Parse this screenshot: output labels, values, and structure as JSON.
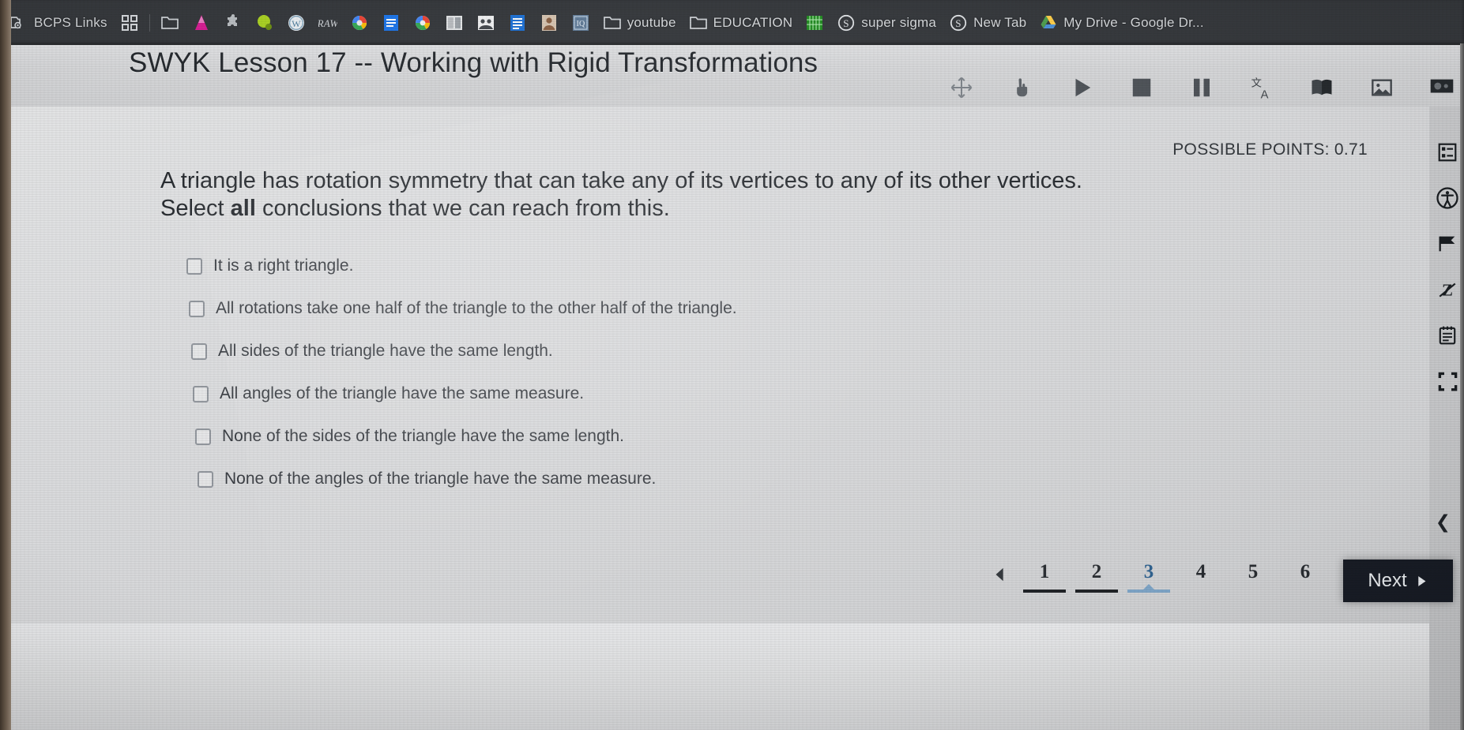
{
  "browser": {
    "bookmarks": [
      {
        "label": "BCPS Links",
        "icon": "folder-gear-icon",
        "kind": "folder"
      },
      {
        "label": "",
        "icon": "apps-grid-icon",
        "kind": "app"
      },
      {
        "label": "",
        "icon": "folder-icon",
        "kind": "folder"
      },
      {
        "label": "",
        "icon": "pink-cone-icon",
        "kind": "site"
      },
      {
        "label": "",
        "icon": "puzzle-piece-icon",
        "kind": "site"
      },
      {
        "label": "",
        "icon": "green-blob-icon",
        "kind": "site"
      },
      {
        "label": "",
        "icon": "wordpress-icon",
        "kind": "site"
      },
      {
        "label": "",
        "icon": "raw-text-icon",
        "kind": "site"
      },
      {
        "label": "",
        "icon": "google-icon",
        "kind": "site"
      },
      {
        "label": "",
        "icon": "blue-doc-icon",
        "kind": "site"
      },
      {
        "label": "",
        "icon": "google-multicolor-icon",
        "kind": "site"
      },
      {
        "label": "",
        "icon": "cards-icon",
        "kind": "site"
      },
      {
        "label": "",
        "icon": "people-photo-icon",
        "kind": "site"
      },
      {
        "label": "",
        "icon": "blue-document-icon",
        "kind": "site"
      },
      {
        "label": "",
        "icon": "portrait-photo-icon",
        "kind": "site"
      },
      {
        "label": "",
        "icon": "iq-blueprint-icon",
        "kind": "site"
      },
      {
        "label": "youtube",
        "icon": "folder-icon",
        "kind": "folder"
      },
      {
        "label": "EDUCATION",
        "icon": "folder-icon",
        "kind": "folder"
      },
      {
        "label": "",
        "icon": "green-grid-icon",
        "kind": "site"
      },
      {
        "label": "super sigma",
        "icon": "sigma-circle-icon",
        "kind": "site"
      },
      {
        "label": "New Tab",
        "icon": "sigma-circle-icon",
        "kind": "site"
      },
      {
        "label": "My Drive - Google Dr...",
        "icon": "google-drive-icon",
        "kind": "site"
      }
    ]
  },
  "header": {
    "title": "SWYK Lesson 17 -- Working with Rigid Transformations",
    "toolbar": [
      {
        "name": "move-tool",
        "glyph": "✥"
      },
      {
        "name": "hand-pointer-tool",
        "glyph": "☝"
      },
      {
        "name": "play-button",
        "glyph": "▶"
      },
      {
        "name": "stop-button",
        "glyph": "■"
      },
      {
        "name": "pause-button",
        "glyph": "❚❚"
      },
      {
        "name": "translate-icon",
        "glyph": "文A"
      },
      {
        "name": "book-icon",
        "glyph": "📖"
      },
      {
        "name": "image-icon",
        "glyph": "🖼"
      },
      {
        "name": "presentation-icon",
        "glyph": "📽"
      }
    ]
  },
  "assessment": {
    "possible_points_label": "POSSIBLE POINTS:",
    "possible_points_value": "0.71",
    "question_line1": "A triangle has rotation symmetry that can take any of its vertices to any of its other vertices.",
    "question_line2_prefix": "Select ",
    "question_line2_bold": "all",
    "question_line2_suffix": " conclusions that we can reach from this.",
    "options": [
      {
        "label": "It is a right triangle.",
        "checked": false
      },
      {
        "label": "All rotations take one half of the triangle to the other half of the triangle.",
        "checked": false
      },
      {
        "label": "All sides of the triangle have the same length.",
        "checked": false
      },
      {
        "label": "All angles of the triangle have the same measure.",
        "checked": false
      },
      {
        "label": "None of the sides of the triangle have the same length.",
        "checked": false
      },
      {
        "label": "None of the angles of the triangle have the same measure.",
        "checked": false
      }
    ],
    "pagination": {
      "prev_glyph": "◀",
      "pages": [
        {
          "number": "1",
          "state": "done"
        },
        {
          "number": "2",
          "state": "done"
        },
        {
          "number": "3",
          "state": "active"
        },
        {
          "number": "4",
          "state": "todo"
        },
        {
          "number": "5",
          "state": "todo"
        },
        {
          "number": "6",
          "state": "todo"
        }
      ]
    },
    "next_label": "Next",
    "next_glyph": "▶"
  },
  "rail": {
    "icons": [
      {
        "name": "question-list-icon"
      },
      {
        "name": "accessibility-icon"
      },
      {
        "name": "flag-icon"
      },
      {
        "name": "strikethrough-pen-icon"
      },
      {
        "name": "notepad-icon"
      },
      {
        "name": "fullscreen-icon"
      }
    ],
    "collapse_glyph": "❮"
  },
  "colors": {
    "bookmark_bar": "#33363a",
    "page_bg": "#d8d9db",
    "active_page": "#2b5f8e",
    "active_underline": "#7ba3c6",
    "next_button": "#141821"
  }
}
